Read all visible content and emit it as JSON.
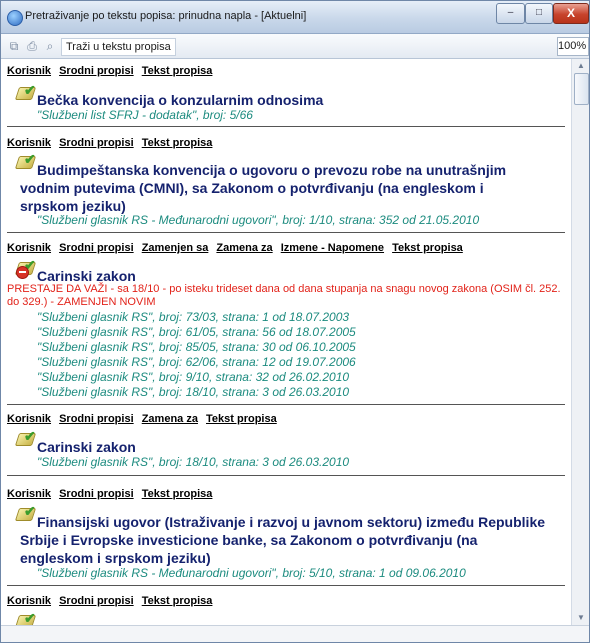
{
  "window": {
    "title": "Pretraživanje po tekstu popisa: prinudna napla - [Aktuelni]",
    "buttons": {
      "minimize": "–",
      "maximize": "□",
      "close": "X"
    }
  },
  "toolbar": {
    "search_label": "Traži u tekstu propisa",
    "zoom": "100%"
  },
  "entries": [
    {
      "links": [
        "Korisnik",
        "Srodni propisi",
        "Tekst propisa"
      ],
      "title": "Bečka konvencija o konzularnim odnosima",
      "publications": [
        "\"Službeni list SFRJ - dodatak\", broj: 5/66"
      ]
    },
    {
      "links": [
        "Korisnik",
        "Srodni propisi",
        "Tekst propisa"
      ],
      "title": "Budimpeštanska konvencija o ugovoru o prevozu robe na unutrašnjim vodnim putevima (CMNI), sa Zakonom o potvrđivanju (na engleskom i srpskom jeziku)",
      "publications": [
        "\"Službeni glasnik RS - Međunarodni ugovori\", broj: 1/10, strana: 352 od 21.05.2010"
      ]
    },
    {
      "links": [
        "Korisnik",
        "Srodni propisi",
        "Zamenjen sa",
        "Zamena za",
        "Izmene - Napomene",
        "Tekst propisa"
      ],
      "title": "Carinski zakon",
      "status": "PRESTAJE DA VAŽI - sa 18/10 - po isteku trideset dana od dana stupanja na snagu novog zakona (OSIM čl. 252. do 329.) - ZAMENJEN NOVIM",
      "publications": [
        "\"Službeni glasnik RS\", broj: 73/03, strana: 1 od 18.07.2003",
        "\"Službeni glasnik RS\", broj: 61/05, strana: 56 od 18.07.2005",
        "\"Službeni glasnik RS\", broj: 85/05, strana: 30 od 06.10.2005",
        "\"Službeni glasnik RS\", broj: 62/06, strana: 12 od 19.07.2006",
        "\"Službeni glasnik RS\", broj: 9/10, strana: 32 od 26.02.2010",
        "\"Službeni glasnik RS\", broj: 18/10, strana: 3 od 26.03.2010"
      ]
    },
    {
      "links": [
        "Korisnik",
        "Srodni propisi",
        "Zamena za",
        "Tekst propisa"
      ],
      "title": "Carinski zakon",
      "publications": [
        "\"Službeni glasnik RS\", broj: 18/10, strana: 3 od 26.03.2010"
      ]
    },
    {
      "links": [
        "Korisnik",
        "Srodni propisi",
        "Tekst propisa"
      ],
      "title": "Finansijski ugovor (Istraživanje i razvoj u javnom sektoru) između Republike Srbije i Evropske investicione banke, sa Zakonom o potvrđivanju (na engleskom i srpskom jeziku)",
      "publications": [
        "\"Službeni glasnik RS - Međunarodni ugovori\", broj: 5/10, strana: 1 od 09.06.2010"
      ]
    },
    {
      "links": [
        "Korisnik",
        "Srodni propisi",
        "Tekst propisa"
      ]
    }
  ]
}
